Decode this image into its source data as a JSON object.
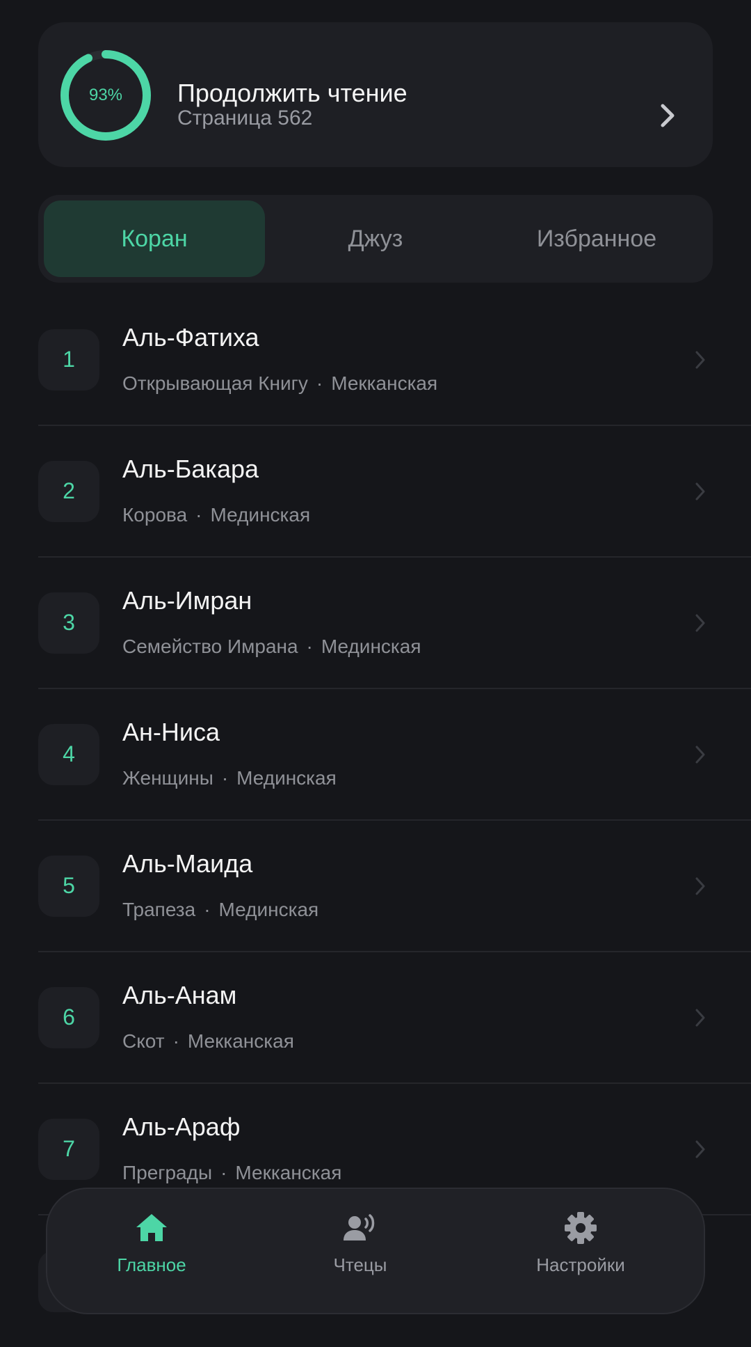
{
  "colors": {
    "accent": "#4dd6a6",
    "background": "#15161a",
    "card": "#1e1f24",
    "active_tab_bg": "#1f3a33",
    "muted_text": "#8f9197"
  },
  "continue_reading": {
    "progress_percent": 93,
    "progress_label": "93%",
    "title": "Продолжить чтение",
    "subtitle": "Страница 562",
    "icon": "chevron-right-icon"
  },
  "tabs": [
    {
      "label": "Коран",
      "active": true
    },
    {
      "label": "Джуз",
      "active": false
    },
    {
      "label": "Избранное",
      "active": false
    }
  ],
  "surahs": [
    {
      "number": "1",
      "name": "Аль-Фатиха",
      "meaning": "Открывающая Книгу",
      "origin": "Мекканская"
    },
    {
      "number": "2",
      "name": "Аль-Бакара",
      "meaning": "Корова",
      "origin": "Мединская"
    },
    {
      "number": "3",
      "name": "Аль-Имран",
      "meaning": "Семейство Имрана",
      "origin": "Мединская"
    },
    {
      "number": "4",
      "name": "Ан-Ниса",
      "meaning": "Женщины",
      "origin": "Мединская"
    },
    {
      "number": "5",
      "name": "Аль-Маида",
      "meaning": "Трапеза",
      "origin": "Мединская"
    },
    {
      "number": "6",
      "name": "Аль-Анам",
      "meaning": "Скот",
      "origin": "Мекканская"
    },
    {
      "number": "7",
      "name": "Аль-Араф",
      "meaning": "Преграды",
      "origin": "Мекканская"
    }
  ],
  "separator": "·",
  "bottom_nav": [
    {
      "label": "Главное",
      "icon": "home-icon",
      "active": true
    },
    {
      "label": "Чтецы",
      "icon": "reciter-icon",
      "active": false
    },
    {
      "label": "Настройки",
      "icon": "gear-icon",
      "active": false
    }
  ]
}
